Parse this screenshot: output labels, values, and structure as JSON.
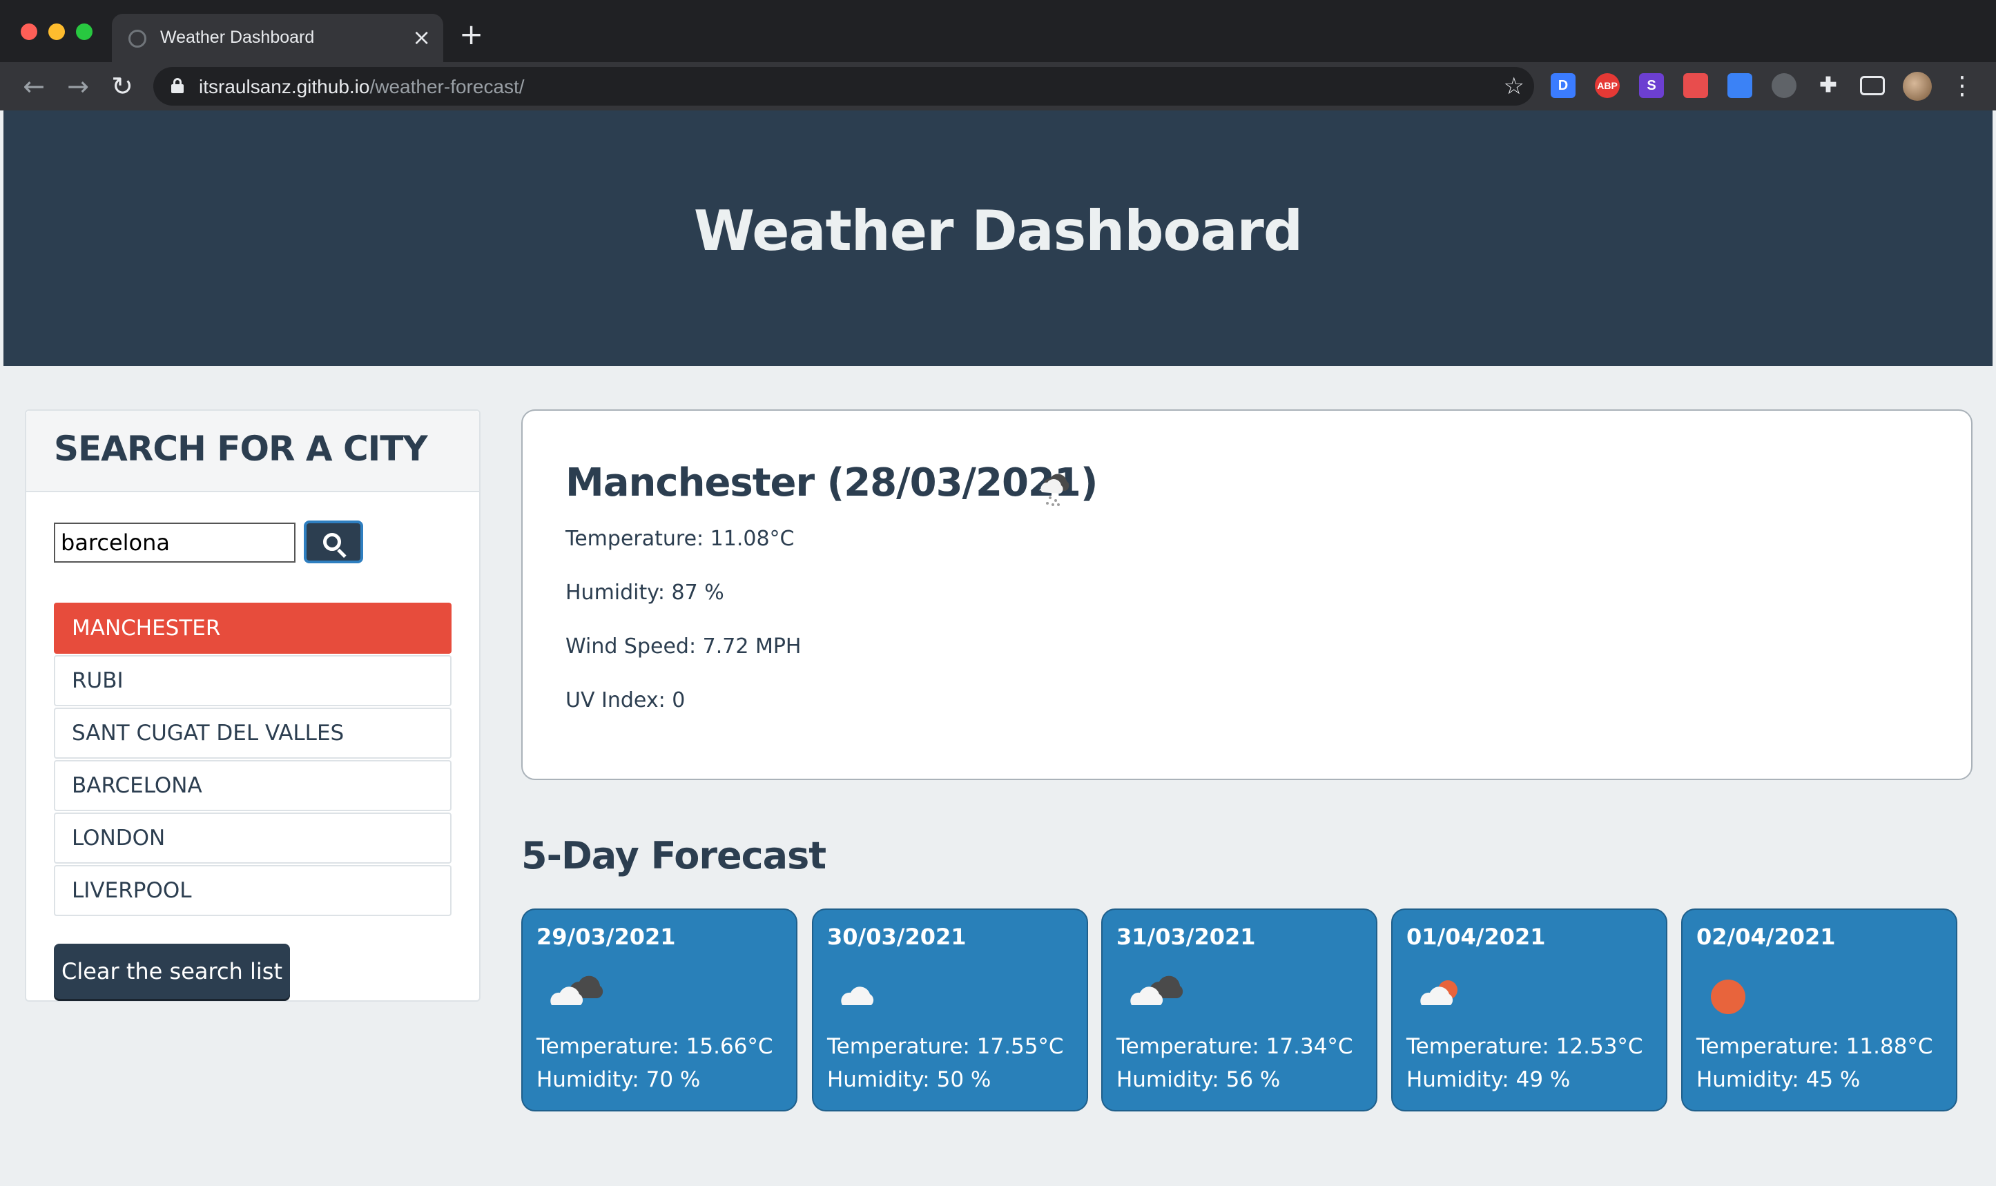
{
  "browser": {
    "tab_title": "Weather Dashboard",
    "tab_close": "×",
    "new_tab": "+",
    "url_host": "itsraulsanz.github.io",
    "url_path": "/weather-forecast/",
    "extensions": [
      {
        "name": "D",
        "color": "#3b7cff"
      },
      {
        "name": "ABP",
        "color": "#e53935"
      },
      {
        "name": "S",
        "color": "#6c3fd1"
      },
      {
        "name": "",
        "color": "#e84d4d"
      },
      {
        "name": "",
        "color": "#3b82f6"
      },
      {
        "name": "",
        "color": "#5f6368"
      },
      {
        "name": "",
        "color": "#35363a"
      },
      {
        "name": "",
        "color": "#35363a"
      }
    ]
  },
  "header": {
    "title": "Weather Dashboard"
  },
  "search": {
    "heading": "SEARCH FOR A CITY",
    "input_value": "barcelona",
    "history": [
      "MANCHESTER",
      "RUBI",
      "SANT CUGAT DEL VALLES",
      "BARCELONA",
      "LONDON",
      "LIVERPOOL"
    ],
    "active_index": 0,
    "clear_label": "Clear the search list"
  },
  "current": {
    "title": "Manchester (28/03/2021)",
    "icon": "light-snow-icon",
    "temperature": "Temperature: 11.08°C",
    "humidity": "Humidity: 87 %",
    "wind": "Wind Speed: 7.72 MPH",
    "uv": "UV Index: 0"
  },
  "forecast": {
    "heading": "5-Day Forecast",
    "days": [
      {
        "date": "29/03/2021",
        "icon": "broken-clouds-icon",
        "temperature": "Temperature: 15.66°C",
        "humidity": "Humidity: 70 %"
      },
      {
        "date": "30/03/2021",
        "icon": "scattered-clouds-icon",
        "temperature": "Temperature: 17.55°C",
        "humidity": "Humidity: 50 %"
      },
      {
        "date": "31/03/2021",
        "icon": "broken-clouds-icon",
        "temperature": "Temperature: 17.34°C",
        "humidity": "Humidity: 56 %"
      },
      {
        "date": "01/04/2021",
        "icon": "few-clouds-icon",
        "temperature": "Temperature: 12.53°C",
        "humidity": "Humidity: 49 %"
      },
      {
        "date": "02/04/2021",
        "icon": "clear-sky-icon",
        "temperature": "Temperature: 11.88°C",
        "humidity": "Humidity: 45 %"
      }
    ]
  },
  "colors": {
    "header_bg": "#2c3e50",
    "active_city": "#e74c3c",
    "forecast_card": "#2980b9",
    "page_bg": "#eceff1"
  }
}
